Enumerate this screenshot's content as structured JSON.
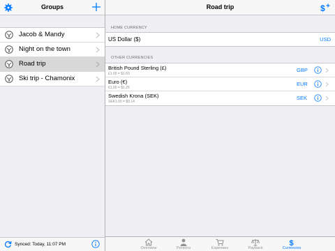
{
  "left_pane": {
    "title": "Groups",
    "groups": [
      {
        "label": "Jacob & Mandy",
        "selected": false
      },
      {
        "label": "Night on the town",
        "selected": false
      },
      {
        "label": "Road trip",
        "selected": true
      },
      {
        "label": "Ski trip - Chamonix",
        "selected": false
      }
    ],
    "footer": {
      "sync_text": "Synced: Today, 11:07 PM"
    }
  },
  "right_pane": {
    "title": "Road trip",
    "home_section_label": "HOME CURRENCY",
    "home_currency": {
      "name": "US Dollar ($)",
      "code": "USD"
    },
    "other_section_label": "OTHER CURRENCIES",
    "other_currencies": [
      {
        "name": "British Pound Sterling (£)",
        "rate": "£1.00 = $1.60",
        "code": "GBP"
      },
      {
        "name": "Euro (€)",
        "rate": "€1.00 = $1.25",
        "code": "EUR"
      },
      {
        "name": "Swedish Krona (SEK)",
        "rate": "SEK1.00 = $0.14",
        "code": "SEK"
      }
    ]
  },
  "tabbar": {
    "tabs": [
      {
        "label": "Overview",
        "icon": "home-icon",
        "active": false
      },
      {
        "label": "Persons",
        "icon": "person-icon",
        "active": false
      },
      {
        "label": "Expenses",
        "icon": "cart-icon",
        "active": false
      },
      {
        "label": "Payback",
        "icon": "scales-icon",
        "active": false
      },
      {
        "label": "Currencies",
        "icon": "dollar-icon",
        "active": true
      }
    ]
  },
  "colors": {
    "accent": "#007aff",
    "inactive_tab": "#929292",
    "selected_row": "#d8d8d8",
    "grouped_background": "#efeff4"
  }
}
